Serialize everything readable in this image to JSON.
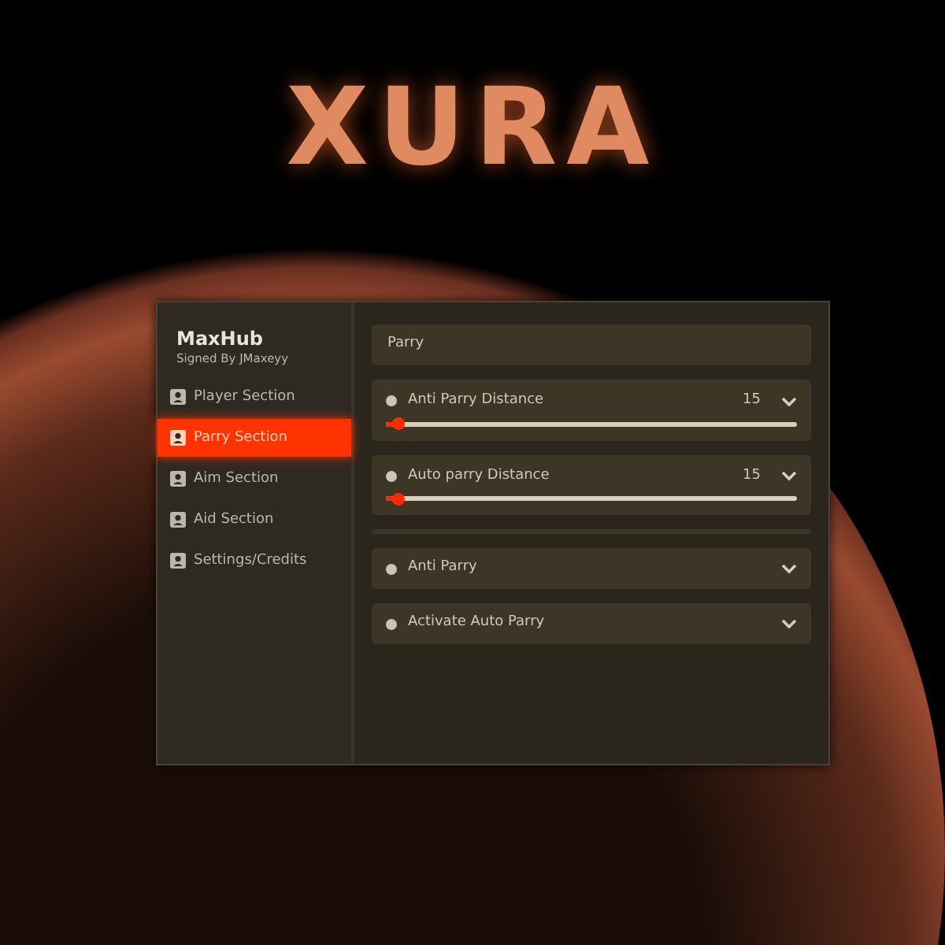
{
  "logo": {
    "text": "XURA"
  },
  "sidebar": {
    "title": "MaxHub",
    "subtitle": "Signed By JMaxeyy",
    "items": [
      {
        "label": "Player Section",
        "selected": false
      },
      {
        "label": "Parry Section",
        "selected": true
      },
      {
        "label": "Aim Section",
        "selected": false
      },
      {
        "label": "Aid Section",
        "selected": false
      },
      {
        "label": "Settings/Credits",
        "selected": false
      }
    ]
  },
  "content": {
    "header": "Parry",
    "rows": [
      {
        "kind": "slider",
        "label": "Anti Parry Distance",
        "value": "15",
        "level": 0.02
      },
      {
        "kind": "slider",
        "label": "Auto parry Distance",
        "value": "15",
        "level": 0.02
      },
      {
        "kind": "divider"
      },
      {
        "kind": "dropdown",
        "label": "Anti Parry"
      },
      {
        "kind": "dropdown",
        "label": "Activate Auto Parry"
      }
    ]
  }
}
